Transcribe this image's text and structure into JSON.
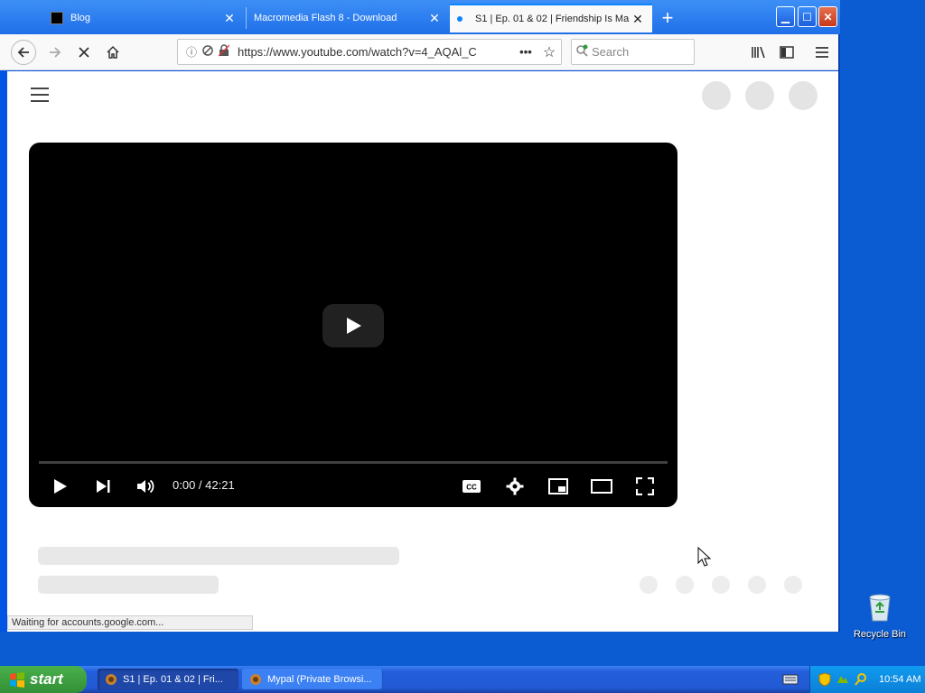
{
  "browser": {
    "tabs": [
      {
        "label": "Blog",
        "active": false
      },
      {
        "label": "Macromedia Flash 8 - Download",
        "active": false
      },
      {
        "label": "S1 | Ep. 01 & 02 | Friendship Is Ma",
        "active": true
      }
    ],
    "new_tab_label": "+",
    "url": "https://www.youtube.com/watch?v=4_AQAl_C",
    "search_placeholder": "Search",
    "status_text": "Waiting for accounts.google.com..."
  },
  "player": {
    "time": "0:00 / 42:21",
    "progress_fraction": 0.0
  },
  "desktop": {
    "recycle_bin_label": "Recycle Bin"
  },
  "taskbar": {
    "start_label": "start",
    "items": [
      {
        "label": "S1 | Ep. 01 & 02 | Fri...",
        "active": true
      },
      {
        "label": "Mypal (Private Browsi...",
        "active": false
      }
    ],
    "clock": "10:54 AM"
  },
  "colors": {
    "xp_blue": "#245edb",
    "start_green": "#3a9d3d",
    "tab_accent": "#0a84ff",
    "close_red": "#d1452a"
  },
  "icons": [
    "back-arrow-icon",
    "forward-arrow-icon",
    "stop-icon",
    "home-icon",
    "info-icon",
    "tracking-icon",
    "lock-icon",
    "more-icon",
    "star-icon",
    "search-icon",
    "library-icon",
    "sidebar-icon",
    "menu-icon",
    "play-icon",
    "next-icon",
    "volume-icon",
    "cc-icon",
    "settings-icon",
    "miniplayer-icon",
    "theater-icon",
    "fullscreen-icon"
  ]
}
